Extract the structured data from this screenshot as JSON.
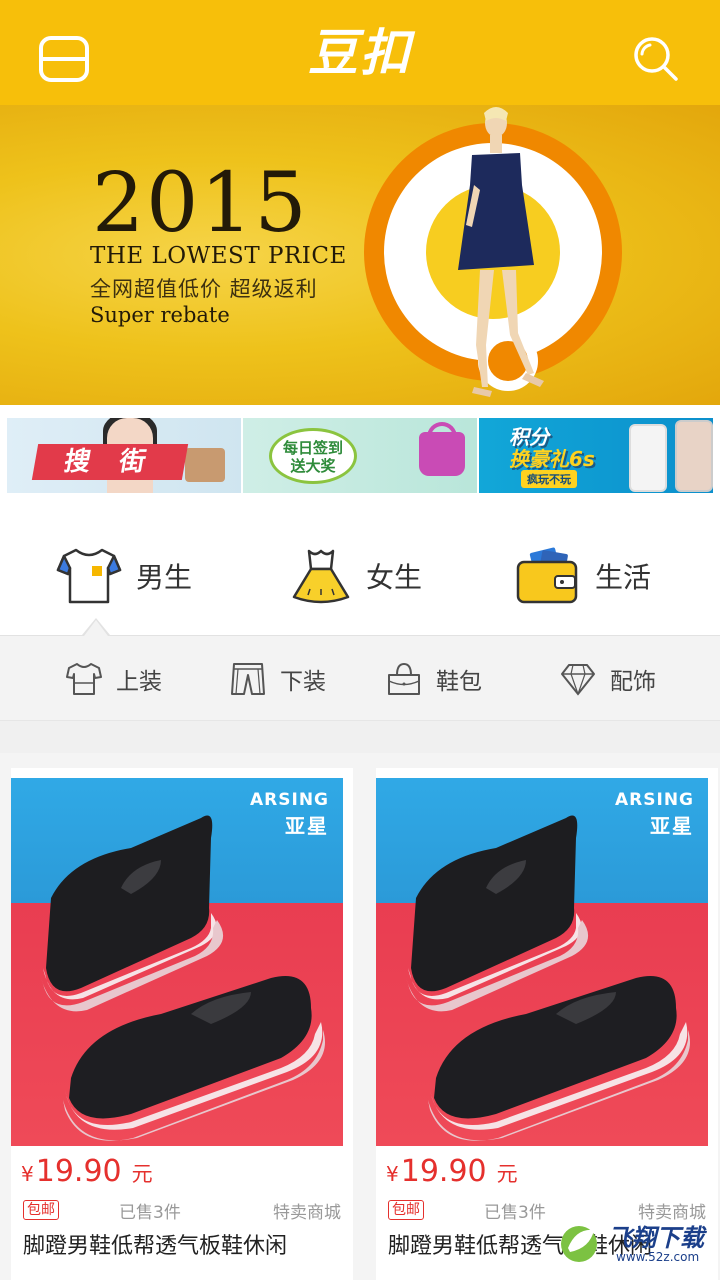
{
  "header": {
    "logo": "豆扣",
    "brand_color": "#f7bf0a"
  },
  "banner": {
    "year": "2015",
    "subtitle": "THE LOWEST PRICE",
    "cn_text": "全网超值低价 超级返利",
    "en_text": "Super rebate"
  },
  "promos": [
    {
      "label": "搜 街"
    },
    {
      "label_line1": "每日签到",
      "label_line2": "送大奖"
    },
    {
      "label_line1": "积分",
      "label_line2": "换豪礼6s",
      "tag": "疯玩不玩"
    }
  ],
  "tabs": [
    {
      "label": "男生",
      "icon": "tshirt-icon"
    },
    {
      "label": "女生",
      "icon": "dress-icon"
    },
    {
      "label": "生活",
      "icon": "wallet-icon"
    }
  ],
  "subcategories": [
    {
      "label": "上装",
      "icon": "shirt-outline-icon"
    },
    {
      "label": "下装",
      "icon": "pants-outline-icon"
    },
    {
      "label": "鞋包",
      "icon": "handbag-outline-icon"
    },
    {
      "label": "配饰",
      "icon": "diamond-outline-icon"
    }
  ],
  "products": [
    {
      "brand_en": "ARSING",
      "brand_cn": "亚星",
      "currency": "¥",
      "price": "19.90",
      "unit": "元",
      "badge": "包邮",
      "sold": "已售3件",
      "mall": "特卖商城",
      "title": "脚蹬男鞋低帮透气板鞋休闲"
    },
    {
      "brand_en": "ARSING",
      "brand_cn": "亚星",
      "currency": "¥",
      "price": "19.90",
      "unit": "元",
      "badge": "包邮",
      "sold": "已售3件",
      "mall": "特卖商城",
      "title": "脚蹬男鞋低帮透气板鞋休闲"
    }
  ],
  "watermark": {
    "text": "飞翔下载",
    "url": "www.52z.com"
  },
  "colors": {
    "accent": "#f7bf0a",
    "price": "#e5302d"
  }
}
